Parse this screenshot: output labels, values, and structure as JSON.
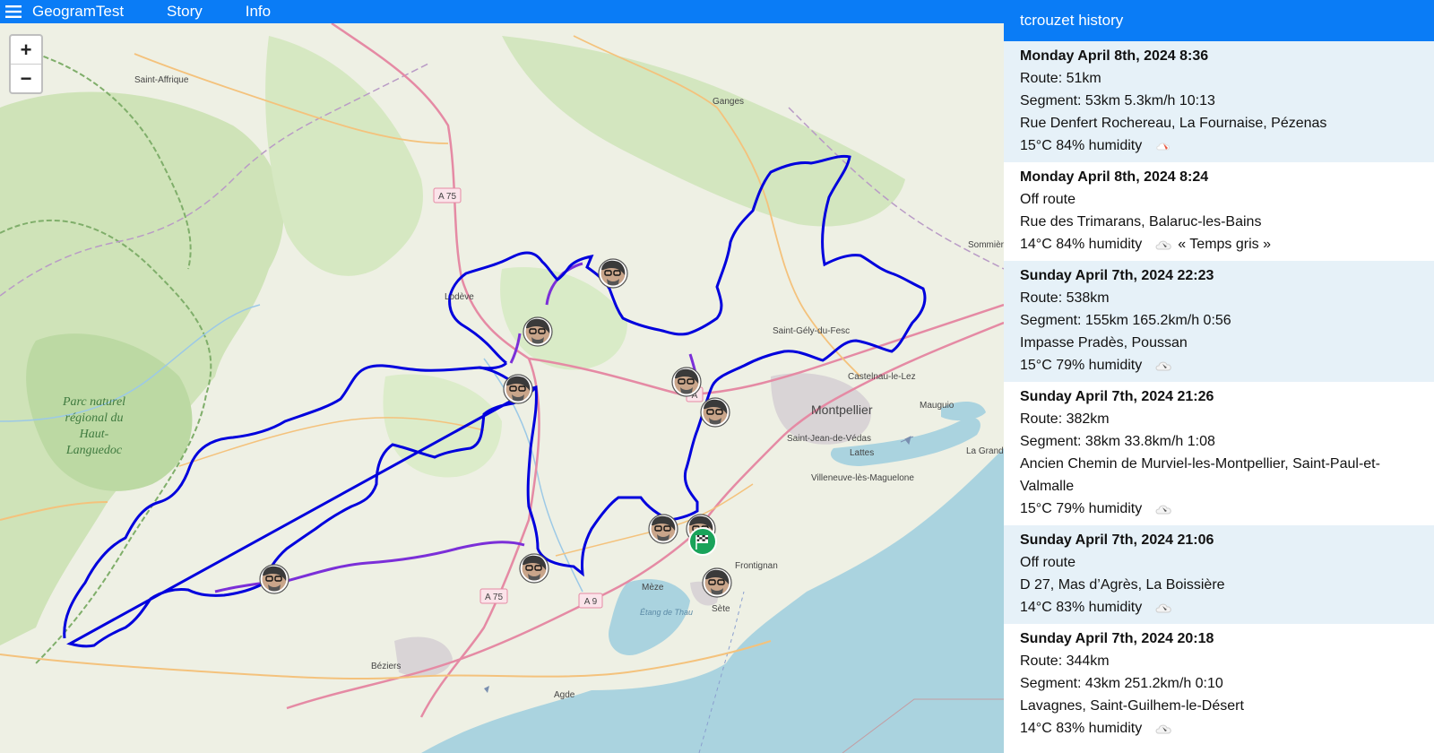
{
  "nav": {
    "brand": "GeogramTest",
    "links": [
      "Story",
      "Info"
    ]
  },
  "zoom": {
    "in": "+",
    "out": "−"
  },
  "map": {
    "places": [
      "Saint-Affrique",
      "Ganges",
      "Lodève",
      "Saint-Gély-du-Fesc",
      "Sommières",
      "Castelnau-le-Lez",
      "Montpellier",
      "Mauguio",
      "Saint-Jean-de-Védas",
      "Lattes",
      "Villeneuve-lès-Maguelone",
      "La Grande-Motte",
      "Frontignan",
      "Mèze",
      "Sète",
      "Étang de Thau",
      "Béziers",
      "Agde"
    ],
    "park": "Parc naturel régional du Haut-Languedoc",
    "roads": [
      "A 75",
      "A 75",
      "A 9",
      "A"
    ],
    "route_color": "#0000dd",
    "offroute_color": "#7b2fd8"
  },
  "history": {
    "title": "tcrouzet history",
    "entries": [
      {
        "when": "Monday April 8th, 2024 8:36",
        "route": "Route: 51km",
        "segment": "Segment: 53km  5.3km/h  10:13",
        "address": "Rue Denfert Rochereau, La Fournaise, Pézenas",
        "weather": "15°C 84% humidity",
        "icon": "rain-icon",
        "note": ""
      },
      {
        "when": "Monday April 8th, 2024 8:24",
        "route": "Off route",
        "segment": "",
        "address": "Rue des Trimarans, Balaruc-les-Bains",
        "weather": "14°C 84% humidity",
        "icon": "cloud-icon",
        "note": "« Temps gris »"
      },
      {
        "when": "Sunday April 7th, 2024 22:23",
        "route": "Route: 538km",
        "segment": "Segment: 155km  165.2km/h  0:56",
        "address": "Impasse Pradès, Poussan",
        "weather": "15°C 79% humidity",
        "icon": "cloud-icon",
        "note": ""
      },
      {
        "when": "Sunday April 7th, 2024 21:26",
        "route": "Route: 382km",
        "segment": "Segment: 38km  33.8km/h  1:08",
        "address": "Ancien Chemin de Murviel-les-Montpellier, Saint-Paul-et-Valmalle",
        "weather": "15°C 79% humidity",
        "icon": "cloud-icon",
        "note": ""
      },
      {
        "when": "Sunday April 7th, 2024 21:06",
        "route": "Off route",
        "segment": "",
        "address": "D 27, Mas d’Agrès, La Boissière",
        "weather": "14°C 83% humidity",
        "icon": "cloud-icon",
        "note": ""
      },
      {
        "when": "Sunday April 7th, 2024 20:18",
        "route": "Route: 344km",
        "segment": "Segment: 43km  251.2km/h  0:10",
        "address": "Lavagnes, Saint-Guilhem-le-Désert",
        "weather": "14°C 83% humidity",
        "icon": "cloud-icon",
        "note": ""
      }
    ]
  }
}
